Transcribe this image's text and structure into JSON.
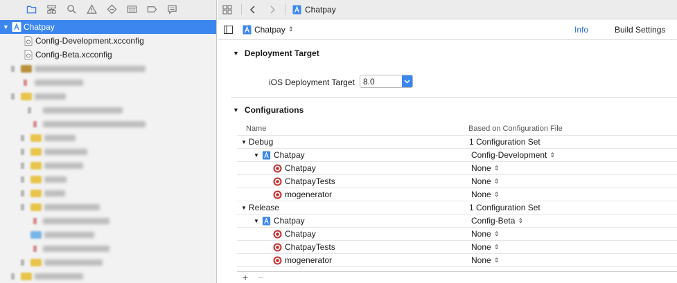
{
  "colors": {
    "selection": "#3b86ef",
    "accent_tab": "#2d6fd6",
    "target_red": "#c62b2b",
    "folder_yellow": "#e8c54a"
  },
  "navigator": {
    "toolbar_icons": [
      "folder-icon",
      "hierarchy-icon",
      "search-icon",
      "warning-icon",
      "test-icon",
      "breakpoint-list-icon",
      "tag-icon",
      "log-icon"
    ],
    "project_name": "Chatpay",
    "files": [
      "Config-Development.xcconfig",
      "Config-Beta.xcconfig"
    ]
  },
  "jump_bar": {
    "project_name": "Chatpay"
  },
  "target_bar": {
    "selected_target": "Chatpay",
    "tabs": {
      "info": "Info",
      "build_settings": "Build Settings"
    }
  },
  "deployment": {
    "section_title": "Deployment Target",
    "label": "iOS Deployment Target",
    "value": "8.0"
  },
  "configurations": {
    "section_title": "Configurations",
    "col_name": "Name",
    "col_based": "Based on Configuration File",
    "groups": [
      {
        "name": "Debug",
        "summary": "1 Configuration Set",
        "project": {
          "name": "Chatpay",
          "file": "Config-Development"
        },
        "targets": [
          {
            "name": "Chatpay",
            "file": "None"
          },
          {
            "name": "ChatpayTests",
            "file": "None"
          },
          {
            "name": "mogenerator",
            "file": "None"
          }
        ]
      },
      {
        "name": "Release",
        "summary": "1 Configuration Set",
        "project": {
          "name": "Chatpay",
          "file": "Config-Beta"
        },
        "targets": [
          {
            "name": "Chatpay",
            "file": "None"
          },
          {
            "name": "ChatpayTests",
            "file": "None"
          },
          {
            "name": "mogenerator",
            "file": "None"
          }
        ]
      }
    ]
  },
  "bottom_bar": {
    "add": "+",
    "remove": "−"
  }
}
